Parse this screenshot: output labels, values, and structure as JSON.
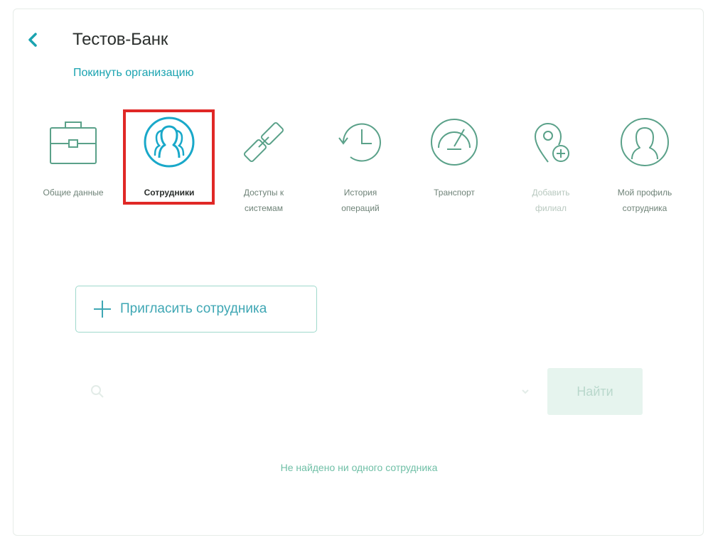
{
  "header": {
    "title": "Тестов-Банк",
    "leave_link": "Покинуть организацию"
  },
  "nav": {
    "items": [
      {
        "label": "Общие данные",
        "icon": "briefcase-icon",
        "state": "normal"
      },
      {
        "label": "Сотрудники",
        "icon": "employees-icon",
        "state": "active"
      },
      {
        "label": "Доступы к\nсистемам",
        "icon": "link-icon",
        "state": "normal"
      },
      {
        "label": "История\nопераций",
        "icon": "history-icon",
        "state": "normal"
      },
      {
        "label": "Транспорт",
        "icon": "speedometer-icon",
        "state": "normal"
      },
      {
        "label": "Добавить\nфилиал",
        "icon": "add-location-icon",
        "state": "faded"
      },
      {
        "label": "Мой профиль\nсотрудника",
        "icon": "profile-icon",
        "state": "normal"
      }
    ]
  },
  "actions": {
    "invite_label": "Пригласить сотрудника"
  },
  "search": {
    "placeholder": "",
    "find_label": "Найти"
  },
  "empty_state": "Не найдено ни одного сотрудника",
  "colors": {
    "accent": "#1aa3b0",
    "icon_green": "#5aa189",
    "icon_active": "#19a8c9",
    "highlight": "#e02826"
  }
}
